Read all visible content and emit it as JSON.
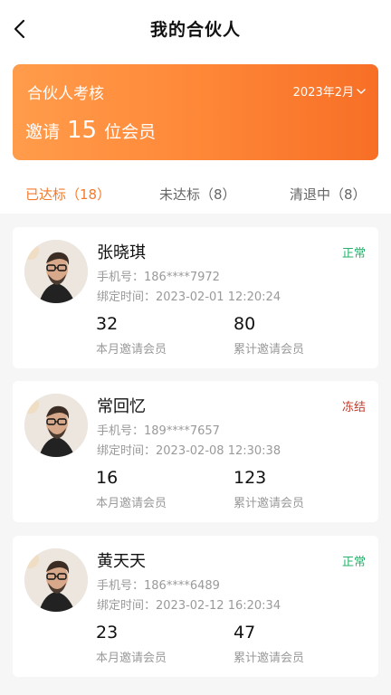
{
  "header": {
    "title": "我的合伙人",
    "back_icon": "chevron-left-icon"
  },
  "assessment": {
    "title": "合伙人考核",
    "month": "2023年2月",
    "invite_prefix": "邀请",
    "invite_count": "15",
    "invite_suffix": "位会员",
    "accent_from": "#ff9c4b",
    "accent_to": "#f76f26"
  },
  "tabs": [
    {
      "label": "已达标（18）",
      "active": true
    },
    {
      "label": "未达标（8）",
      "active": false
    },
    {
      "label": "清退中（8）",
      "active": false
    }
  ],
  "labels": {
    "phone": "手机号：",
    "bind_time": "绑定时间：",
    "month_invites": "本月邀请会员",
    "total_invites": "累计邀请会员"
  },
  "partners": [
    {
      "name": "张晓琪",
      "status": "正常",
      "status_color": "#27b26b",
      "phone": "186****7972",
      "bind_time": "2023-02-01 12:20:24",
      "month_invites": "32",
      "total_invites": "80"
    },
    {
      "name": "常回忆",
      "status": "冻结",
      "status_color": "#c0392b",
      "phone": "189****7657",
      "bind_time": "2023-02-08 12:30:38",
      "month_invites": "16",
      "total_invites": "123"
    },
    {
      "name": "黄天天",
      "status": "正常",
      "status_color": "#27b26b",
      "phone": "186****6489",
      "bind_time": "2023-02-12 16:20:34",
      "month_invites": "23",
      "total_invites": "47"
    }
  ]
}
